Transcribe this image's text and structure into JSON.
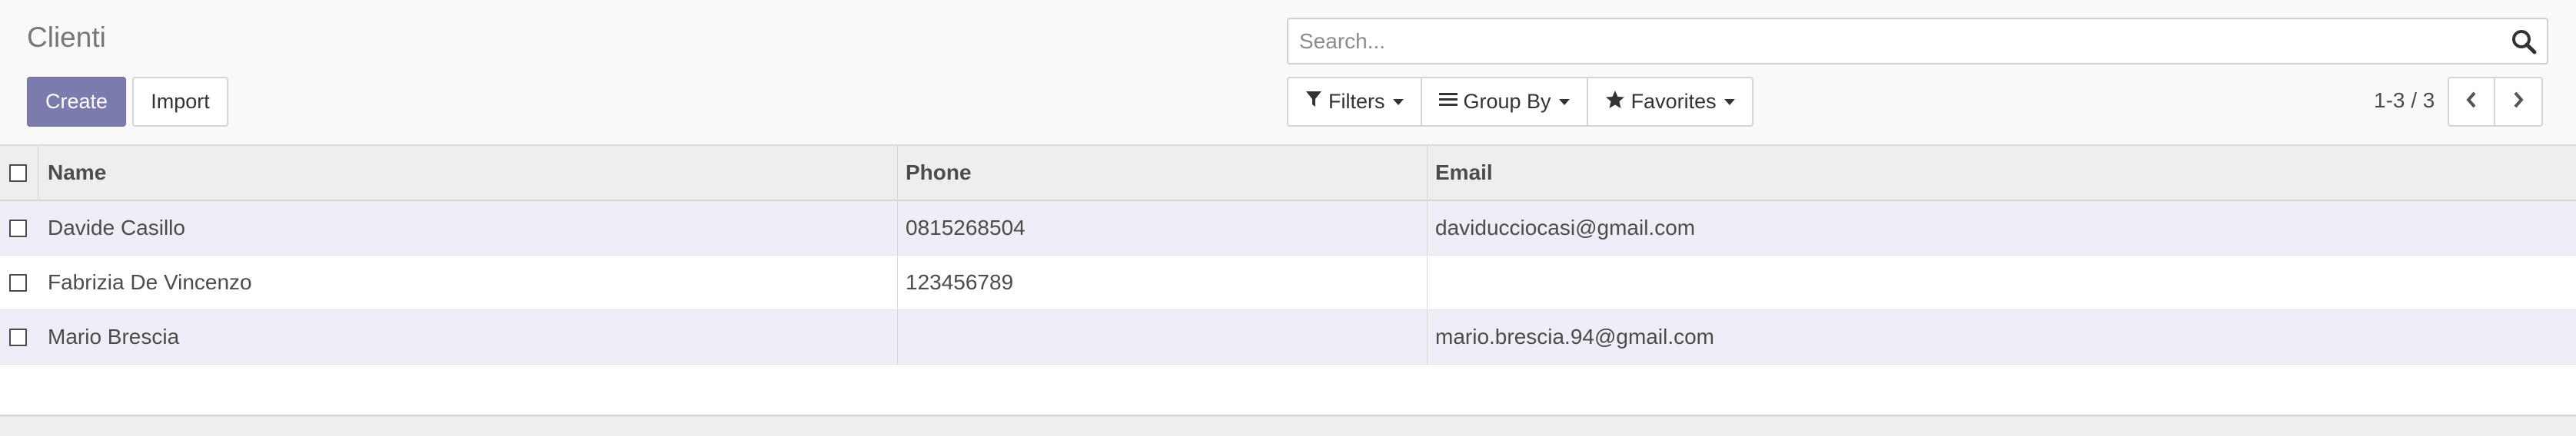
{
  "header": {
    "title": "Clienti",
    "create_label": "Create",
    "import_label": "Import"
  },
  "search": {
    "placeholder": "Search...",
    "icon": "search-icon"
  },
  "filters": {
    "filters_label": "Filters",
    "groupby_label": "Group By",
    "favorites_label": "Favorites"
  },
  "pager": {
    "value": "1-3 / 3"
  },
  "table": {
    "columns": [
      "Name",
      "Phone",
      "Email"
    ],
    "rows": [
      {
        "name": "Davide Casillo",
        "phone": "0815268504",
        "email": "daviducciocasi@gmail.com"
      },
      {
        "name": "Fabrizia De Vincenzo",
        "phone": "123456789",
        "email": ""
      },
      {
        "name": "Mario Brescia",
        "phone": "",
        "email": "mario.brescia.94@gmail.com"
      }
    ]
  },
  "colors": {
    "primary": "#7c7bad",
    "row_stripe": "#eeeef7",
    "header_bg": "#eeeeee"
  }
}
